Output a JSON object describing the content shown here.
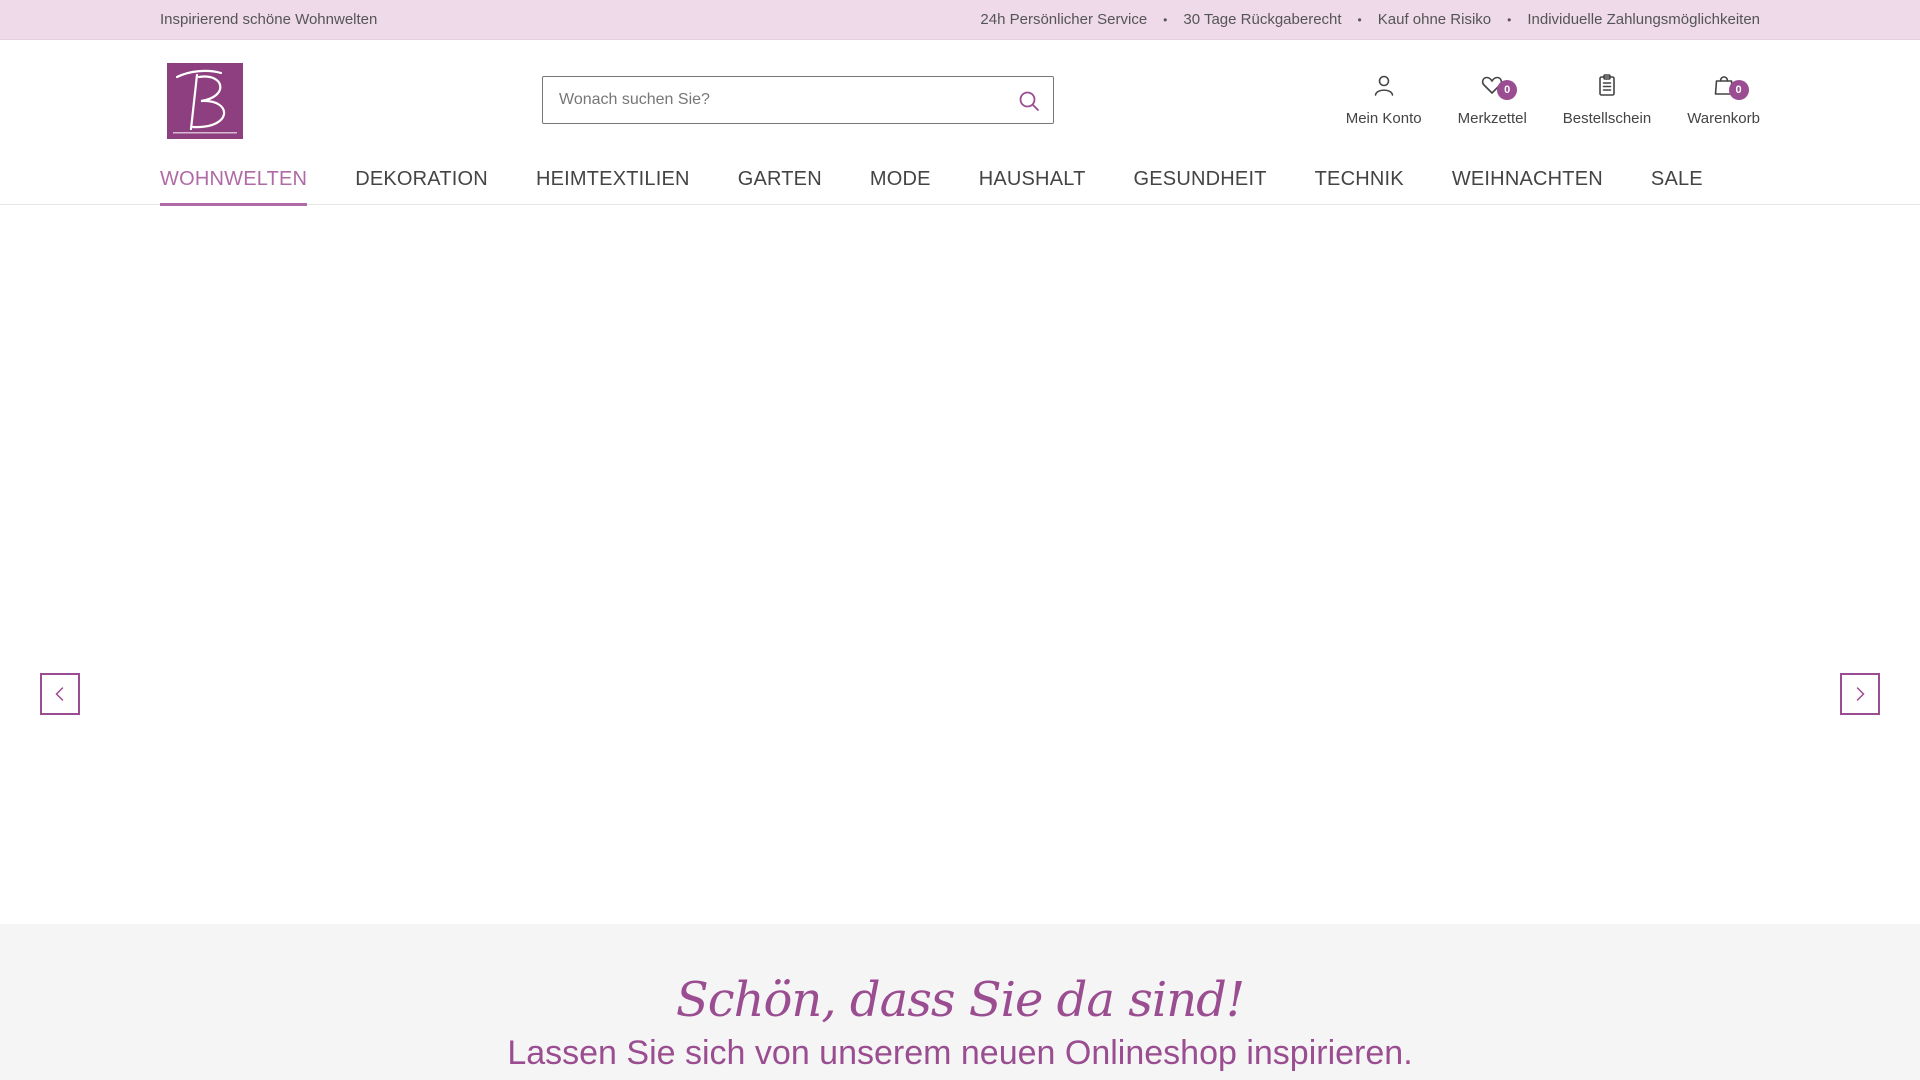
{
  "topbar": {
    "tagline": "Inspirierend schöne Wohnwelten",
    "usps": [
      "24h Persönlicher Service",
      "30 Tage Rückgaberecht",
      "Kauf ohne Risiko",
      "Individuelle Zahlungsmöglichkeiten"
    ],
    "separator": "•"
  },
  "header": {
    "logo": {
      "icon": "brand-logo-icon"
    },
    "search": {
      "placeholder": "Wonach suchen Sie?",
      "value": "",
      "icon": "search-icon"
    },
    "actions": [
      {
        "label": "Mein Konto",
        "icon": "user-icon"
      },
      {
        "label": "Merkzettel",
        "icon": "heart-icon",
        "badge": "0"
      },
      {
        "label": "Bestellschein",
        "icon": "clipboard-icon"
      },
      {
        "label": "Warenkorb",
        "icon": "shopping-bag-icon",
        "badge": "0"
      }
    ]
  },
  "nav": {
    "items": [
      "WOHNWELTEN",
      "DEKORATION",
      "HEIMTEXTILIEN",
      "GARTEN",
      "MODE",
      "HAUSHALT",
      "GESUNDHEIT",
      "TECHNIK",
      "WEIHNACHTEN",
      "SALE"
    ],
    "active": "WOHNWELTEN"
  },
  "slider": {
    "prev_icon": "chevron-left-icon",
    "next_icon": "chevron-right-icon"
  },
  "welcome": {
    "headline": "Schön, dass Sie da sind!",
    "subline": "Lassen Sie sich von unserem neuen Onlineshop inspirieren."
  },
  "colors": {
    "accent": "#9a4d90",
    "topbar_bg": "#efdaea",
    "nav_active": "#b06aa5"
  }
}
